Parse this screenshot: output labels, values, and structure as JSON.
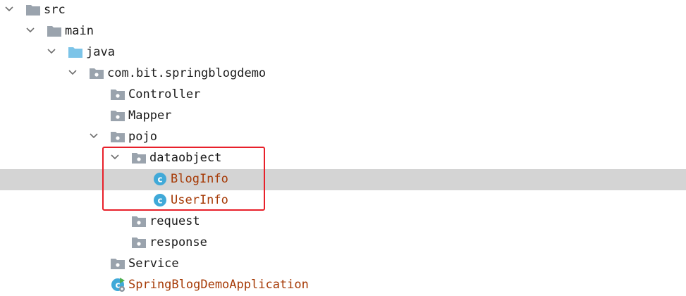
{
  "tree": {
    "rows": [
      {
        "label": "src",
        "icon": "folder-icon",
        "expanded": true,
        "selected": false
      },
      {
        "label": "main",
        "icon": "folder-icon",
        "expanded": true,
        "selected": false
      },
      {
        "label": "java",
        "icon": "source-root-folder-icon",
        "expanded": true,
        "selected": false
      },
      {
        "label": "com.bit.springblogdemo",
        "icon": "package-icon",
        "expanded": true,
        "selected": false
      },
      {
        "label": "Controller",
        "icon": "package-icon",
        "expanded": false,
        "selected": false
      },
      {
        "label": "Mapper",
        "icon": "package-icon",
        "expanded": false,
        "selected": false
      },
      {
        "label": "pojo",
        "icon": "package-icon",
        "expanded": true,
        "selected": false
      },
      {
        "label": "dataobject",
        "icon": "package-icon",
        "expanded": true,
        "selected": false
      },
      {
        "label": "BlogInfo",
        "icon": "class-icon",
        "expanded": false,
        "selected": true
      },
      {
        "label": "UserInfo",
        "icon": "class-icon",
        "expanded": false,
        "selected": false
      },
      {
        "label": "request",
        "icon": "package-icon",
        "expanded": false,
        "selected": false
      },
      {
        "label": "response",
        "icon": "package-icon",
        "expanded": false,
        "selected": false
      },
      {
        "label": "Service",
        "icon": "package-icon",
        "expanded": false,
        "selected": false
      },
      {
        "label": "SpringBlogDemoApplication",
        "icon": "spring-boot-app-icon",
        "expanded": false,
        "selected": false
      }
    ]
  },
  "colors": {
    "class_label": "#a63a06",
    "selection_background": "#d4d4d4",
    "highlight_box": "#e8202a",
    "folder_gray": "#9aa3ad",
    "source_root_blue": "#7cc4e8",
    "class_badge_blue": "#40a9d8"
  }
}
